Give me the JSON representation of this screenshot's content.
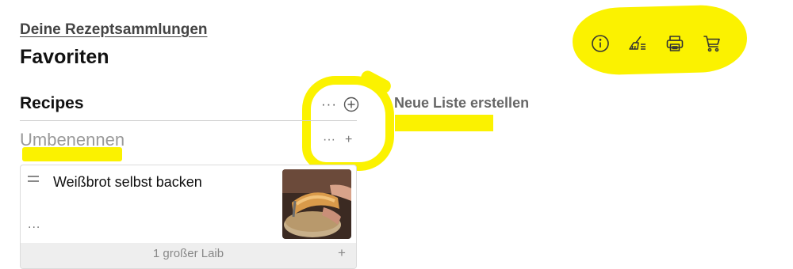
{
  "header": {
    "breadcrumb": "Deine Rezeptsammlungen",
    "title": "Favoriten"
  },
  "toolbar": {
    "items": [
      {
        "icon": "info-icon"
      },
      {
        "icon": "broom-icon"
      },
      {
        "icon": "printer-icon"
      },
      {
        "icon": "shopping-cart-icon"
      }
    ]
  },
  "list": {
    "title": "Recipes",
    "more_label": "···",
    "new_list_label": "Neue Liste erstellen",
    "rename_placeholder": "Umbenennen",
    "rename_more": "···",
    "rename_plus": "+"
  },
  "recipes": [
    {
      "name": "Weißbrot selbst backen",
      "more": "...",
      "quantity": "1 großer Laib",
      "plus": "+"
    }
  ],
  "colors": {
    "highlight": "#fbf200",
    "divider": "#cfcfcf",
    "muted_text": "#9a9a9a"
  }
}
